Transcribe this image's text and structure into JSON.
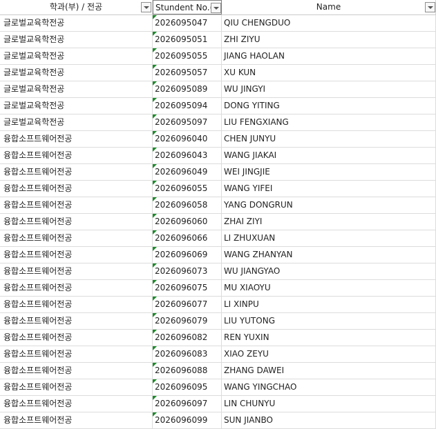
{
  "header": {
    "columns": [
      {
        "label": "학과(부) / 전공"
      },
      {
        "label": "Stundent No.(|"
      },
      {
        "label": "Name"
      }
    ]
  },
  "rows": [
    {
      "dept": "글로벌교육학전공",
      "student_no": "2026095047",
      "name": "QIU CHENGDUO"
    },
    {
      "dept": "글로벌교육학전공",
      "student_no": "2026095051",
      "name": "ZHI ZIYU"
    },
    {
      "dept": "글로벌교육학전공",
      "student_no": "2026095055",
      "name": "JIANG HAOLAN"
    },
    {
      "dept": "글로벌교육학전공",
      "student_no": "2026095057",
      "name": "XU KUN"
    },
    {
      "dept": "글로벌교육학전공",
      "student_no": "2026095089",
      "name": "WU JINGYI"
    },
    {
      "dept": "글로벌교육학전공",
      "student_no": "2026095094",
      "name": "DONG YITING"
    },
    {
      "dept": "글로벌교육학전공",
      "student_no": "2026095097",
      "name": "LIU FENGXIANG"
    },
    {
      "dept": "융합소프트웨어전공",
      "student_no": "2026096040",
      "name": "CHEN JUNYU"
    },
    {
      "dept": "융합소프트웨어전공",
      "student_no": "2026096043",
      "name": "WANG JIAKAI"
    },
    {
      "dept": "융합소프트웨어전공",
      "student_no": "2026096049",
      "name": "WEI JINGJIE"
    },
    {
      "dept": "융합소프트웨어전공",
      "student_no": "2026096055",
      "name": "WANG YIFEI"
    },
    {
      "dept": "융합소프트웨어전공",
      "student_no": "2026096058",
      "name": "YANG DONGRUN"
    },
    {
      "dept": "융합소프트웨어전공",
      "student_no": "2026096060",
      "name": "ZHAI ZIYI"
    },
    {
      "dept": "융합소프트웨어전공",
      "student_no": "2026096066",
      "name": "LI ZHUXUAN"
    },
    {
      "dept": "융합소프트웨어전공",
      "student_no": "2026096069",
      "name": "WANG ZHANYAN"
    },
    {
      "dept": "융합소프트웨어전공",
      "student_no": "2026096073",
      "name": "WU JIANGYAO"
    },
    {
      "dept": "융합소프트웨어전공",
      "student_no": "2026096075",
      "name": "MU XIAOYU"
    },
    {
      "dept": "융합소프트웨어전공",
      "student_no": "2026096077",
      "name": "LI XINPU"
    },
    {
      "dept": "융합소프트웨어전공",
      "student_no": "2026096079",
      "name": "LIU YUTONG"
    },
    {
      "dept": "융합소프트웨어전공",
      "student_no": "2026096082",
      "name": "REN YUXIN"
    },
    {
      "dept": "융합소프트웨어전공",
      "student_no": "2026096083",
      "name": "XIAO ZEYU"
    },
    {
      "dept": "융합소프트웨어전공",
      "student_no": "2026096088",
      "name": "ZHANG DAWEI"
    },
    {
      "dept": "융합소프트웨어전공",
      "student_no": "2026096095",
      "name": "WANG YINGCHAO"
    },
    {
      "dept": "융합소프트웨어전공",
      "student_no": "2026096097",
      "name": "LIN CHUNYU"
    },
    {
      "dept": "융합소프트웨어전공",
      "student_no": "2026096099",
      "name": "SUN JIANBO"
    }
  ],
  "colors": {
    "error_indicator": "#1d8a2b",
    "gridline": "#dcdcdc"
  },
  "icons": {
    "filter": "filter-dropdown-icon",
    "cell_indicator": "number-as-text-indicator-icon"
  }
}
